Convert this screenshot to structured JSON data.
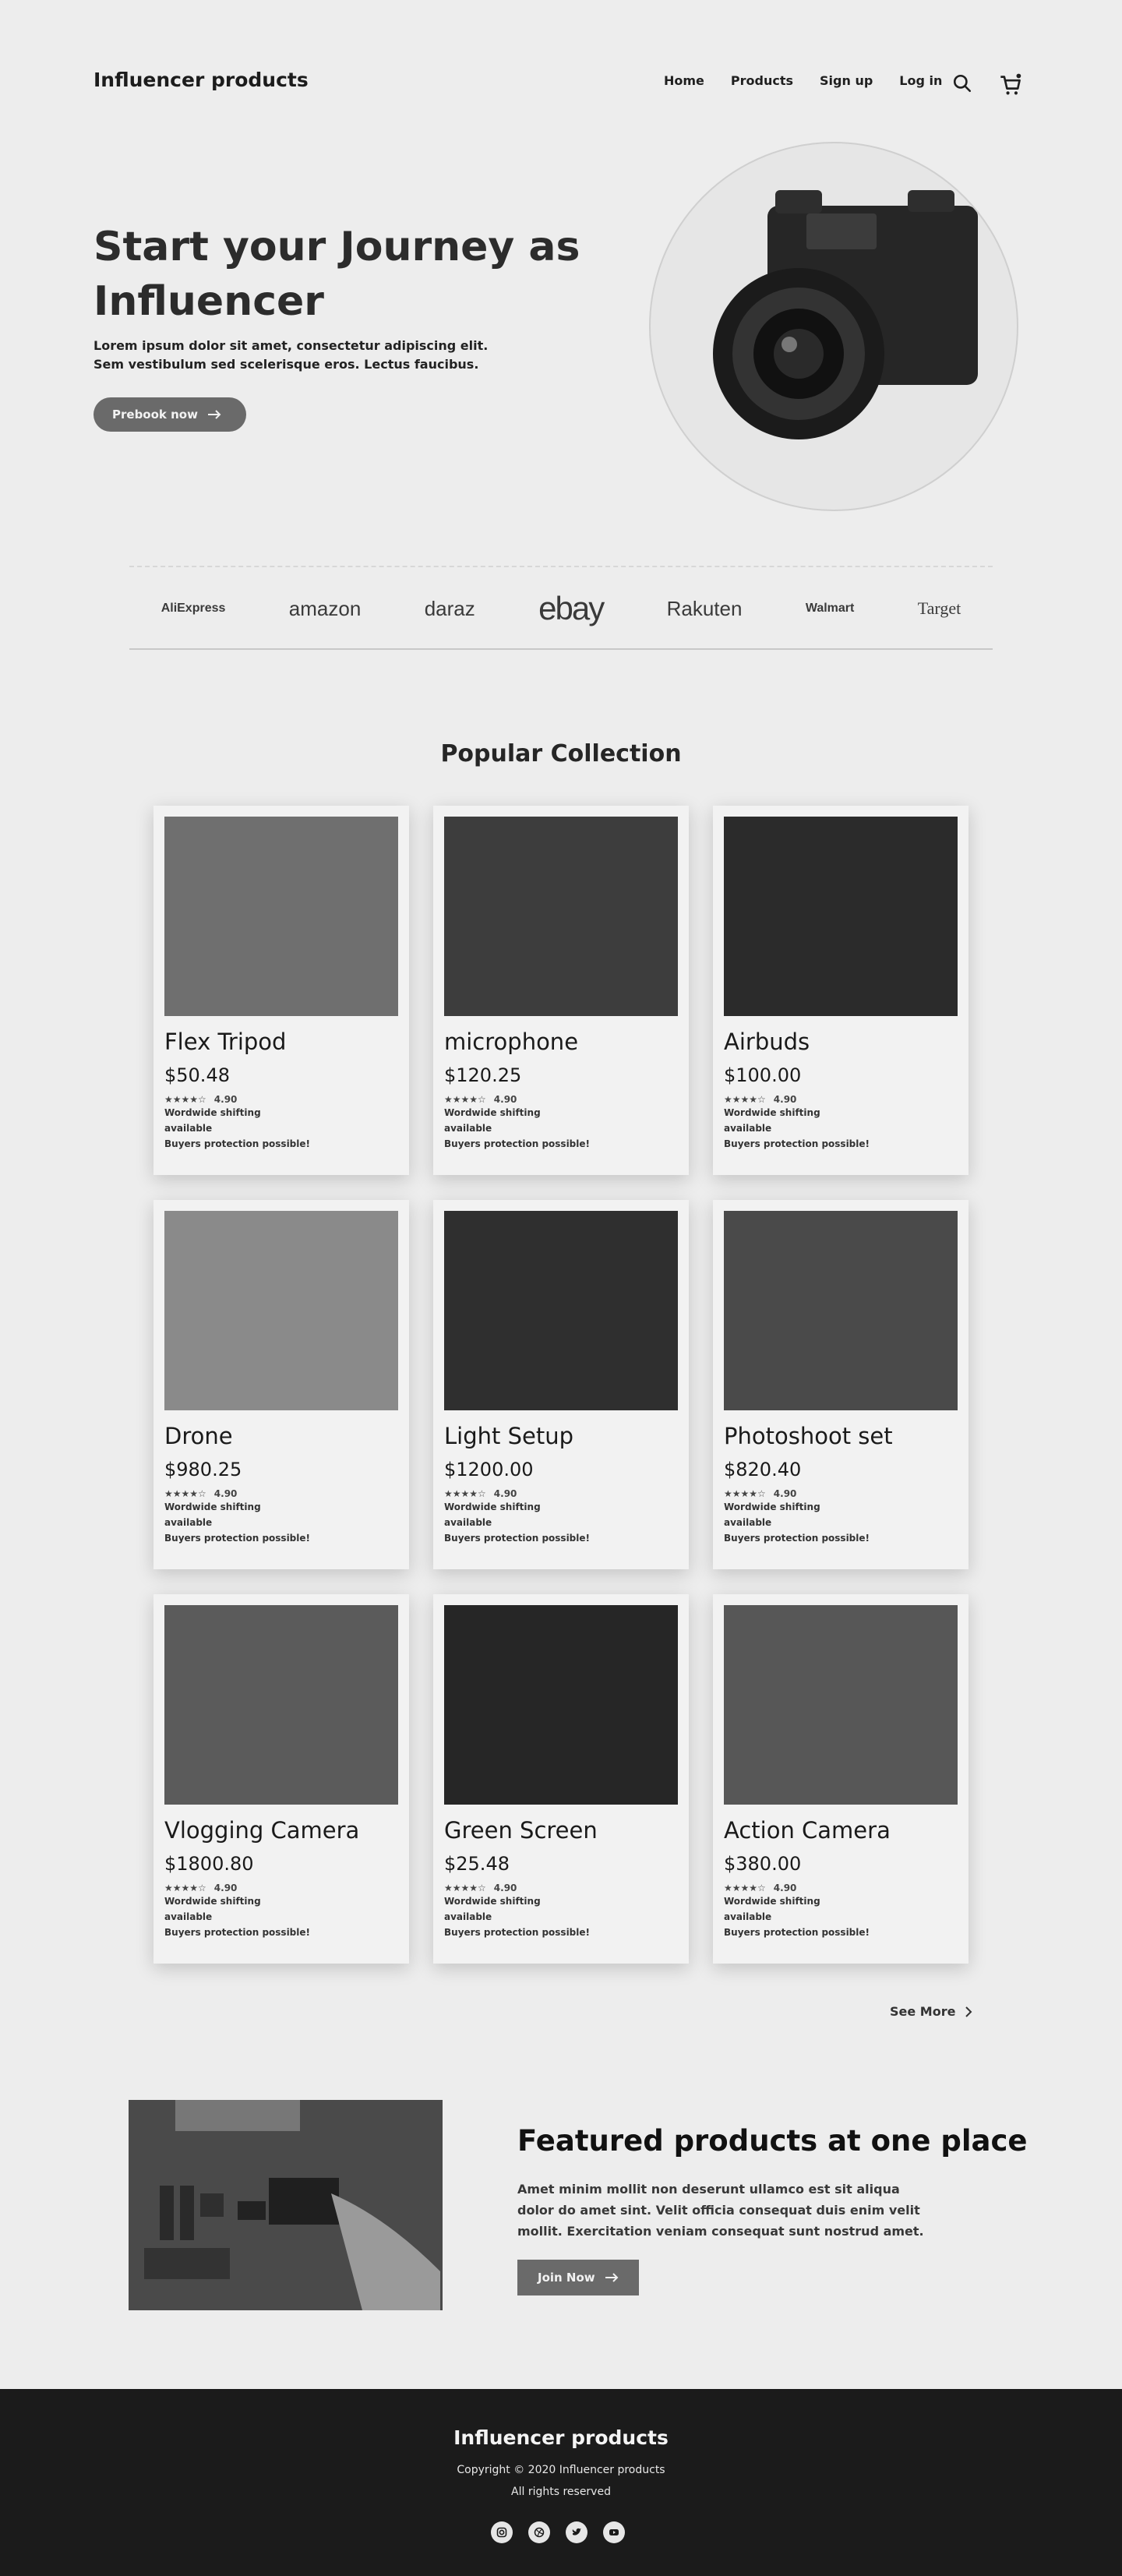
{
  "header": {
    "brand": "Influencer products",
    "nav": [
      "Home",
      "Products",
      "Sign up",
      "Log in"
    ],
    "icons": [
      "search-icon",
      "cart-icon"
    ]
  },
  "hero": {
    "title_line1": "Start your Journey as",
    "title_line2": "Influencer",
    "text": "Lorem ipsum dolor sit amet, consectetur adipiscing elit. Sem vestibulum sed scelerisque eros. Lectus faucibus.",
    "button": "Prebook now"
  },
  "brands": [
    "AliExpress",
    "amazon",
    "daraz",
    "ebay",
    "Rakuten",
    "Walmart",
    "Target"
  ],
  "collection": {
    "title": "Popular Collection",
    "products": [
      {
        "name": "Flex Tripod",
        "price": "$50.48",
        "rating": "4.90",
        "line1": "Wordwide shifting",
        "line2": "available",
        "line3": "Buyers protection possible!"
      },
      {
        "name": "microphone",
        "price": "$120.25",
        "rating": "4.90",
        "line1": "Wordwide shifting",
        "line2": "available",
        "line3": "Buyers protection possible!"
      },
      {
        "name": "Airbuds",
        "price": "$100.00",
        "rating": "4.90",
        "line1": "Wordwide shifting",
        "line2": "available",
        "line3": "Buyers protection possible!"
      },
      {
        "name": "Drone",
        "price": "$980.25",
        "rating": "4.90",
        "line1": "Wordwide shifting",
        "line2": "available",
        "line3": "Buyers protection possible!"
      },
      {
        "name": "Light Setup",
        "price": "$1200.00",
        "rating": "4.90",
        "line1": "Wordwide shifting",
        "line2": "available",
        "line3": "Buyers protection possible!"
      },
      {
        "name": "Photoshoot set",
        "price": "$820.40",
        "rating": "4.90",
        "line1": "Wordwide shifting",
        "line2": "available",
        "line3": "Buyers protection possible!"
      },
      {
        "name": "Vlogging Camera",
        "price": "$1800.80",
        "rating": "4.90",
        "line1": "Wordwide shifting",
        "line2": "available",
        "line3": "Buyers protection possible!"
      },
      {
        "name": "Green Screen",
        "price": "$25.48",
        "rating": "4.90",
        "line1": "Wordwide shifting",
        "line2": "available",
        "line3": "Buyers protection possible!"
      },
      {
        "name": "Action Camera",
        "price": "$380.00",
        "rating": "4.90",
        "line1": "Wordwide shifting",
        "line2": "available",
        "line3": "Buyers protection possible!"
      }
    ],
    "see_more": "See More"
  },
  "featured": {
    "title": "Featured products at one place",
    "text": "Amet minim mollit non deserunt ullamco est sit aliqua dolor do amet sint. Velit officia consequat duis enim velit mollit. Exercitation veniam consequat sunt nostrud amet.",
    "button": "Join Now"
  },
  "footer": {
    "brand": "Influencer products",
    "copyright": "Copyright © 2020 Influencer products",
    "rights": "All rights reserved",
    "social": [
      "instagram-icon",
      "dribbble-icon",
      "twitter-icon",
      "youtube-icon"
    ]
  },
  "colors": {
    "background": "#ededed",
    "button": "#6a6a6a",
    "footer": "#1b1b1b"
  }
}
